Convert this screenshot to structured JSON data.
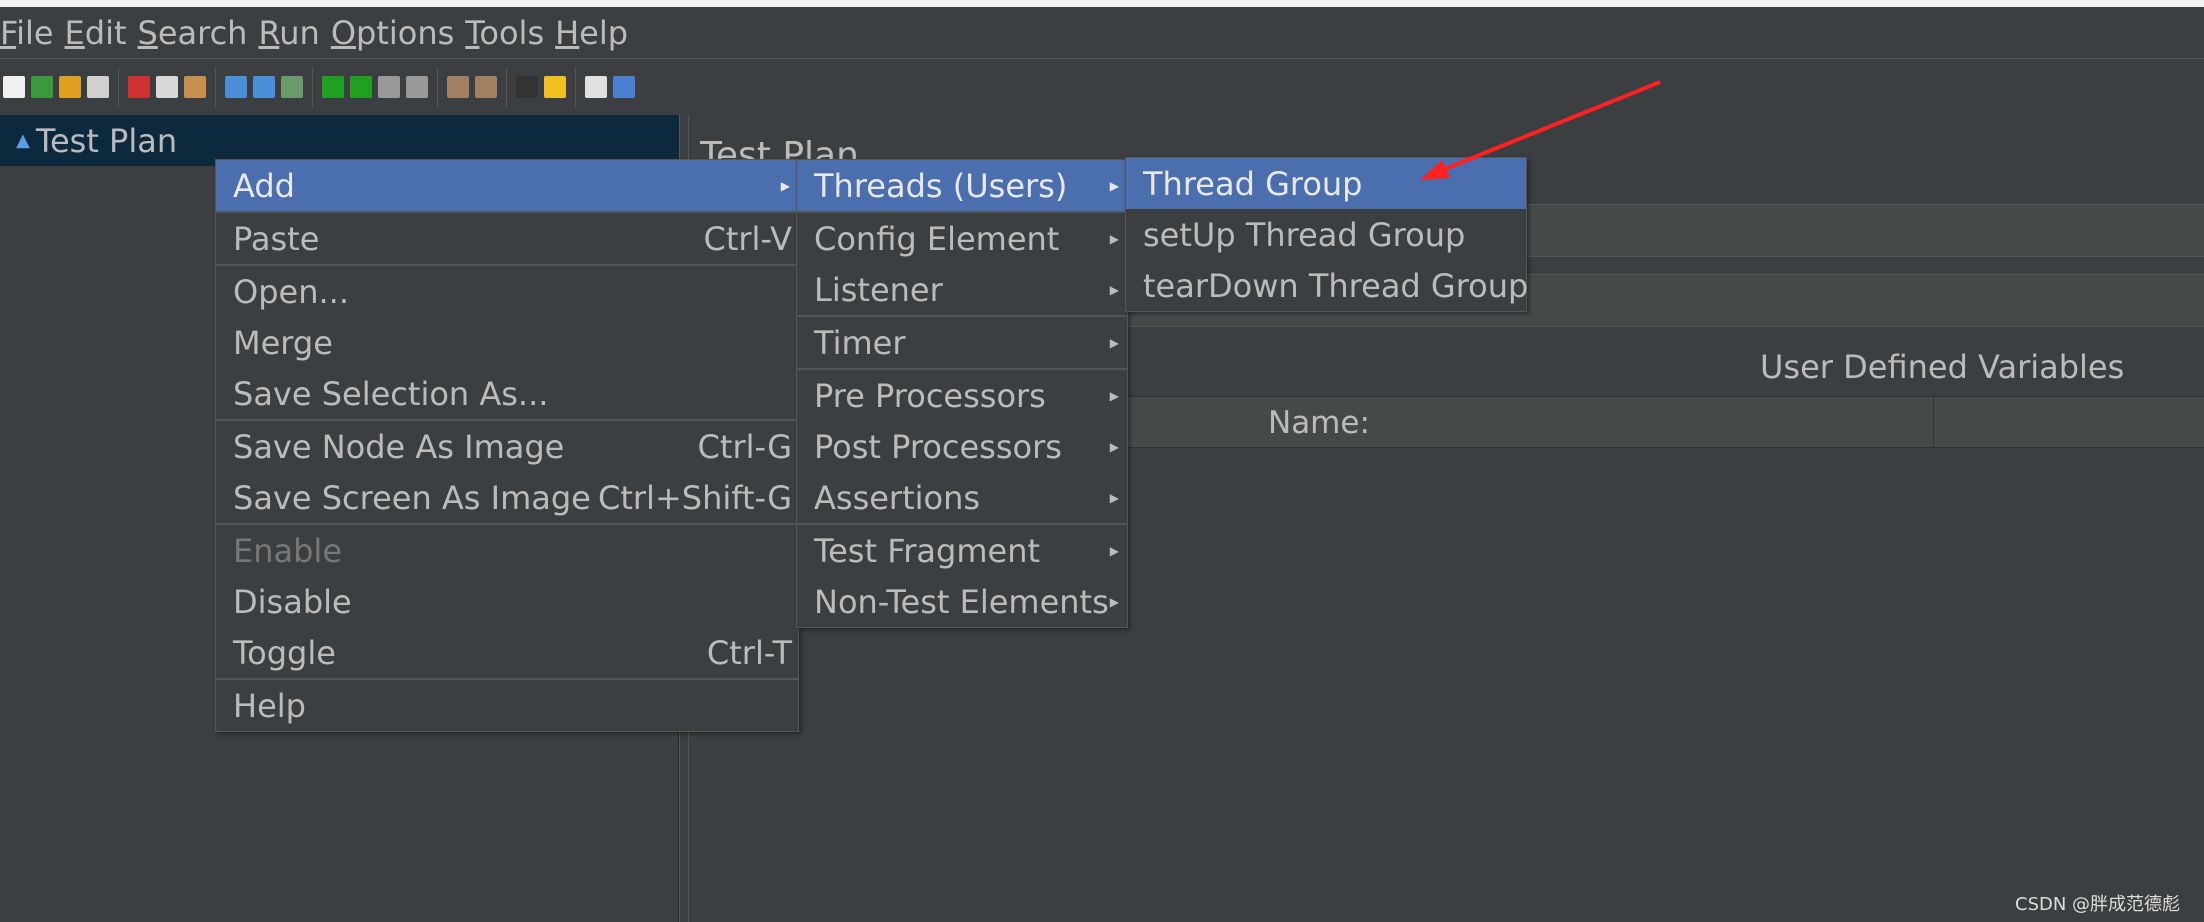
{
  "menubar": [
    {
      "u": "F",
      "rest": "ile"
    },
    {
      "u": "E",
      "rest": "dit"
    },
    {
      "u": "S",
      "rest": "earch"
    },
    {
      "u": "R",
      "rest": "un"
    },
    {
      "u": "O",
      "rest": "ptions"
    },
    {
      "u": "T",
      "rest": "ools"
    },
    {
      "u": "H",
      "rest": "elp"
    }
  ],
  "toolbar": {
    "icons": [
      [
        "new-icon",
        "#f0f0f0"
      ],
      [
        "templates-icon",
        "#3a9a3a"
      ],
      [
        "open-icon",
        "#e0a020"
      ],
      [
        "save-icon",
        "#d0d0d0"
      ],
      "|",
      [
        "cut-icon",
        "#d03030"
      ],
      [
        "copy-icon",
        "#d8d8d8"
      ],
      [
        "paste-icon",
        "#c89050"
      ],
      "|",
      [
        "expand-icon",
        "#4a90d9"
      ],
      [
        "collapse-icon",
        "#4a90d9"
      ],
      [
        "toggle-icon",
        "#6a9a6a"
      ],
      "|",
      [
        "start-icon",
        "#20a020"
      ],
      [
        "start-no-pause-icon",
        "#20a020"
      ],
      [
        "stop-icon",
        "#999999"
      ],
      [
        "shutdown-icon",
        "#999999"
      ],
      "|",
      [
        "clear-icon",
        "#a08060"
      ],
      [
        "clear-all-icon",
        "#a08060"
      ],
      "|",
      [
        "search-icon",
        "#333333"
      ],
      [
        "reset-search-icon",
        "#f0c020"
      ],
      "|",
      [
        "function-helper-icon",
        "#e0e0e0"
      ],
      [
        "help-icon",
        "#4a80d0"
      ]
    ]
  },
  "tree": {
    "root": "Test Plan"
  },
  "right": {
    "title": "Test Plan",
    "udv": "User Defined Variables",
    "col_name": "Name:"
  },
  "context_menu": [
    {
      "label": "Add",
      "selected": true,
      "submenu": true
    },
    "-",
    {
      "label": "Paste",
      "shortcut": "Ctrl-V"
    },
    "-",
    {
      "label": "Open..."
    },
    {
      "label": "Merge"
    },
    {
      "label": "Save Selection As..."
    },
    "-",
    {
      "label": "Save Node As Image",
      "shortcut": "Ctrl-G"
    },
    {
      "label": "Save Screen As Image",
      "shortcut": "Ctrl+Shift-G"
    },
    "-",
    {
      "label": "Enable",
      "disabled": true
    },
    {
      "label": "Disable"
    },
    {
      "label": "Toggle",
      "shortcut": "Ctrl-T"
    },
    "-",
    {
      "label": "Help"
    }
  ],
  "add_submenu": [
    {
      "label": "Threads (Users)",
      "selected": true,
      "submenu": true
    },
    "-",
    {
      "label": "Config Element",
      "submenu": true
    },
    {
      "label": "Listener",
      "submenu": true
    },
    "-",
    {
      "label": "Timer",
      "submenu": true
    },
    "-",
    {
      "label": "Pre Processors",
      "submenu": true
    },
    {
      "label": "Post Processors",
      "submenu": true
    },
    {
      "label": "Assertions",
      "submenu": true
    },
    "-",
    {
      "label": "Test Fragment",
      "submenu": true
    },
    {
      "label": "Non-Test Elements",
      "submenu": true
    }
  ],
  "threads_submenu": [
    {
      "label": "Thread Group",
      "selected": true
    },
    {
      "label": "setUp Thread Group"
    },
    {
      "label": "tearDown Thread Group"
    }
  ],
  "watermark": "CSDN @胖成范德彪",
  "colors": {
    "selection": "#4b6eaf",
    "background": "#3c3f41",
    "annotation_arrow": "#ff2020"
  }
}
